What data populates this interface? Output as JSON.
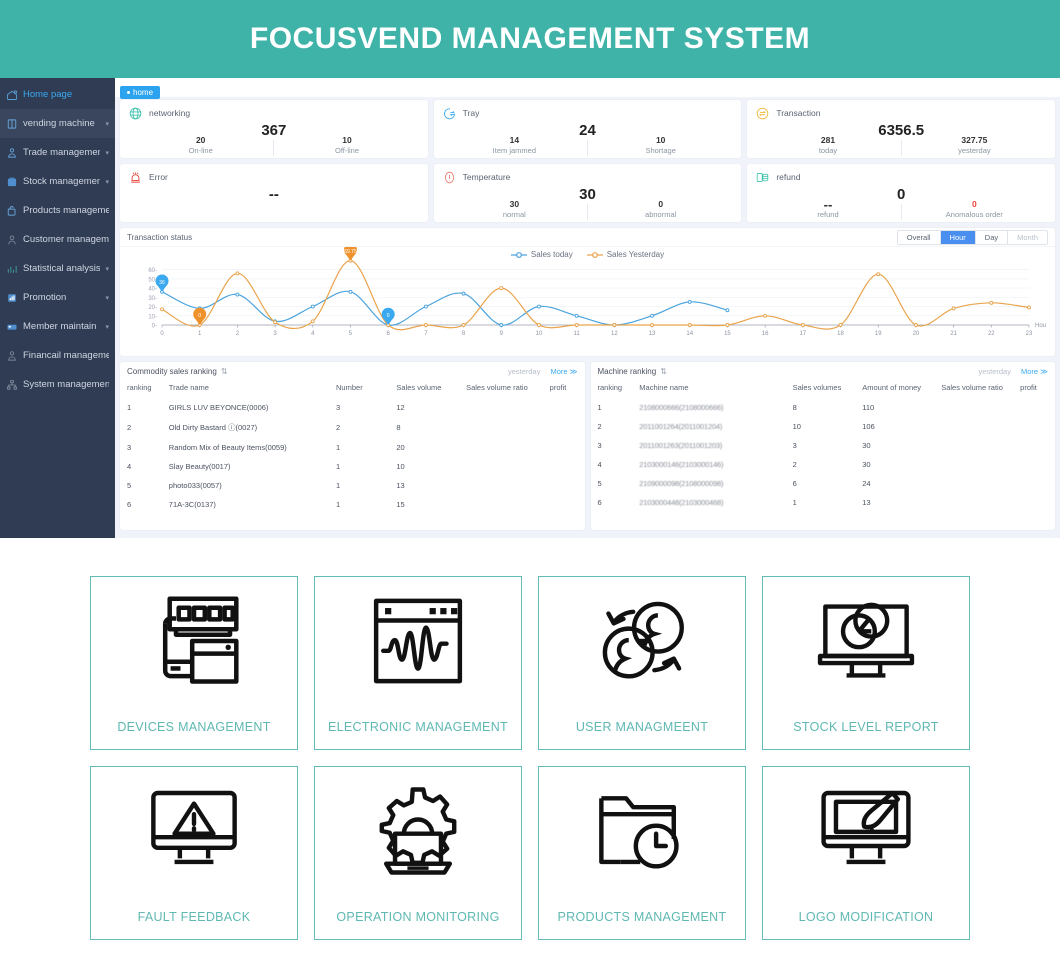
{
  "header": {
    "title": "FOCUSVEND MANAGEMENT SYSTEM",
    "bg": "#3fb3a8"
  },
  "tab": {
    "label": "home"
  },
  "sidebar": {
    "items": [
      {
        "label": "Home page",
        "icon": "home-icon",
        "active": true,
        "caret": false
      },
      {
        "label": "vending machine",
        "icon": "machine-icon",
        "active": false,
        "caret": true
      },
      {
        "label": "Trade management",
        "icon": "trade-icon",
        "active": false,
        "caret": true
      },
      {
        "label": "Stock management",
        "icon": "stock-icon",
        "active": false,
        "caret": true
      },
      {
        "label": "Products management",
        "icon": "product-icon",
        "active": false,
        "caret": false
      },
      {
        "label": "Customer management",
        "icon": "customer-icon",
        "active": false,
        "caret": false
      },
      {
        "label": "Statistical analysis",
        "icon": "stats-icon",
        "active": false,
        "caret": true
      },
      {
        "label": "Promotion",
        "icon": "promotion-icon",
        "active": false,
        "caret": true
      },
      {
        "label": "Member maintain",
        "icon": "member-icon",
        "active": false,
        "caret": true
      },
      {
        "label": "Financail management",
        "icon": "finance-icon",
        "active": false,
        "caret": false
      },
      {
        "label": "System management",
        "icon": "system-icon",
        "active": false,
        "caret": false
      }
    ]
  },
  "stats": {
    "row1": [
      {
        "title": "networking",
        "icon": "globe-icon",
        "accent": "#3fc0ac",
        "main": "367",
        "left_value": "20",
        "left_label": "On-line",
        "right_value": "10",
        "right_label": "Off-line"
      },
      {
        "title": "Tray",
        "icon": "tray-icon",
        "accent": "#3ba9f0",
        "main": "24",
        "left_value": "14",
        "left_label": "Item jammed",
        "right_value": "10",
        "right_label": "Shortage"
      },
      {
        "title": "Transaction",
        "icon": "exchange-icon",
        "accent": "#f0b93b",
        "main": "6356.5",
        "left_value": "281",
        "left_label": "today",
        "right_value": "327.75",
        "right_label": "yesterday"
      }
    ],
    "row2": [
      {
        "title": "Error",
        "icon": "alarm-icon",
        "accent": "#e8443a",
        "main": "--",
        "left_value": "",
        "left_label": "",
        "right_value": "",
        "right_label": ""
      },
      {
        "title": "Temperature",
        "icon": "thermometer-icon",
        "accent": "#e8756a",
        "main": "30",
        "left_value": "30",
        "left_label": "normal",
        "right_value": "0",
        "right_label": "abnormal"
      },
      {
        "title": "refund",
        "icon": "coins-icon",
        "accent": "#3fc0ac",
        "main": "0",
        "left_value": "--",
        "left_label": "refund",
        "right_value": "0",
        "right_label": "Anomalous order",
        "right_red": true
      }
    ]
  },
  "chart_panel": {
    "title": "Transaction status",
    "range_buttons": [
      {
        "label": "Overall",
        "active": false,
        "disabled": false
      },
      {
        "label": "Hour",
        "active": true,
        "disabled": false
      },
      {
        "label": "Day",
        "active": false,
        "disabled": false
      },
      {
        "label": "Month",
        "active": false,
        "disabled": true
      }
    ]
  },
  "chart_data": {
    "type": "line",
    "title": "Transaction status",
    "xlabel": "Hou",
    "ylabel": "",
    "xlim": [
      0,
      23
    ],
    "ylim": [
      0,
      65
    ],
    "yticks": [
      0,
      10,
      20,
      30,
      40,
      50,
      60
    ],
    "x": [
      0,
      1,
      2,
      3,
      4,
      5,
      6,
      7,
      8,
      9,
      10,
      11,
      12,
      13,
      14,
      15,
      16,
      17,
      18,
      19,
      20,
      21,
      22,
      23
    ],
    "grid": true,
    "legend_position": "top-center",
    "series": [
      {
        "name": "Sales today",
        "color": "#4ba3dd",
        "values": [
          36,
          18,
          33,
          4,
          20,
          36,
          0,
          20,
          34,
          0,
          20,
          10,
          0,
          10,
          25,
          16,
          null,
          null,
          null,
          null,
          null,
          null,
          null,
          null
        ],
        "annotations": [
          {
            "x": 0,
            "value": "36",
            "color": "#3ba9f0"
          },
          {
            "x": 6,
            "value": "0",
            "color": "#3ba9f0"
          }
        ]
      },
      {
        "name": "Sales Yesterday",
        "color": "#e9a44c",
        "values": [
          17,
          0,
          56,
          3,
          4,
          69.75,
          0,
          0,
          0,
          40,
          0,
          0,
          0,
          0,
          0,
          0,
          10,
          0,
          0,
          55,
          0,
          18,
          24,
          19
        ],
        "annotations": [
          {
            "x": 5,
            "value": "69.75",
            "color": "#f0922b"
          },
          {
            "x": 1,
            "value": "0",
            "color": "#f0922b"
          }
        ]
      }
    ]
  },
  "commodity_panel": {
    "title": "Commodity sales ranking",
    "period": "yesterday",
    "more": "More ≫",
    "columns": [
      "ranking",
      "Trade name",
      "Number",
      "Sales volume",
      "Sales volume ratio",
      "profit"
    ],
    "rows": [
      [
        "1",
        "GIRLS LUV BEYONCE(0006)",
        "3",
        "12",
        "",
        ""
      ],
      [
        "2",
        "Old Dirty Bastard ⓘ(0027)",
        "2",
        "8",
        "",
        ""
      ],
      [
        "3",
        "Random Mix of Beauty Items(0059)",
        "1",
        "20",
        "",
        ""
      ],
      [
        "4",
        "Slay Beauty(0017)",
        "1",
        "10",
        "",
        ""
      ],
      [
        "5",
        "photo033(0057)",
        "1",
        "13",
        "",
        ""
      ],
      [
        "6",
        "71A-3C(0137)",
        "1",
        "15",
        "",
        ""
      ]
    ]
  },
  "machine_panel": {
    "title": "Machine ranking",
    "period": "yesterday",
    "more": "More ≫",
    "columns": [
      "ranking",
      "Machine name",
      "Sales volumes",
      "Amount of money",
      "Sales volume ratio",
      "profit"
    ],
    "rows": [
      [
        "1",
        "2108000666(2108000666)",
        "8",
        "110",
        "",
        ""
      ],
      [
        "2",
        "2011001264(2011001204)",
        "10",
        "106",
        "",
        ""
      ],
      [
        "3",
        "2011001263(2011001203)",
        "3",
        "30",
        "",
        ""
      ],
      [
        "4",
        "2103000146(2103000146)",
        "2",
        "30",
        "",
        ""
      ],
      [
        "5",
        "2109000098(2108000098)",
        "6",
        "24",
        "",
        ""
      ],
      [
        "6",
        "2103000448(2103000468)",
        "1",
        "13",
        "",
        ""
      ]
    ]
  },
  "shortcuts": {
    "accent": "#63bdb6",
    "label_color": "#5fb8b2",
    "tiles": [
      {
        "label": "DEVICES MANAGEMENT",
        "icon": "server-device-icon"
      },
      {
        "label": "ELECTRONIC MANAGEMENT",
        "icon": "waveform-window-icon"
      },
      {
        "label": "USER MANAGMEENT",
        "icon": "users-sync-icon"
      },
      {
        "label": "STOCK LEVEL REPORT",
        "icon": "monitor-chart-icon"
      },
      {
        "label": "FAULT FEEDBACK",
        "icon": "monitor-warning-icon"
      },
      {
        "label": "OPERATION MONITORING",
        "icon": "gear-laptop-icon"
      },
      {
        "label": "PRODUCTS MANAGEMENT",
        "icon": "folder-clock-icon"
      },
      {
        "label": "LOGO MODIFICATION",
        "icon": "monitor-brush-icon"
      }
    ]
  }
}
